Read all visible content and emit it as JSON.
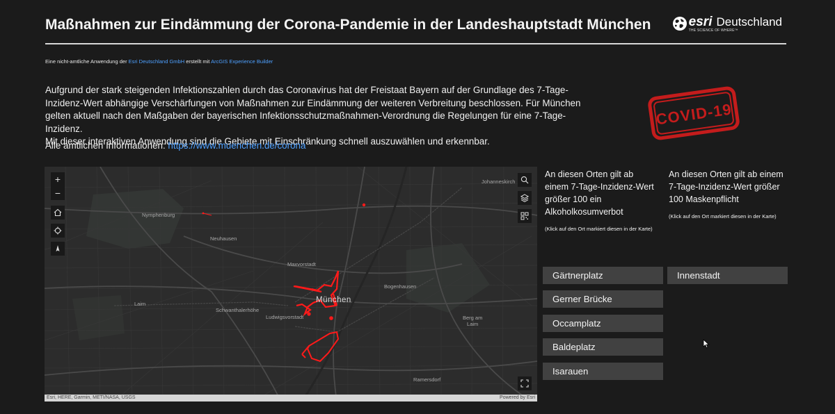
{
  "header": {
    "title": "Maßnahmen zur Eindämmung der Corona-Pandemie in der Landeshauptstadt München",
    "logo": {
      "brand": "esri",
      "region": "Deutschland",
      "tagline": "THE SCIENCE OF WHERE™"
    }
  },
  "credit": {
    "prefix": "Eine nicht-amtliche Anwendung der",
    "company": "Esri Deutschland GmbH",
    "middle": "erstellt mit",
    "tool": "ArcGIS Experience Builder"
  },
  "intro": {
    "paragraph": "Aufgrund der stark steigenden Infektionszahlen durch das Coronavirus hat der Freistaat Bayern auf der Grundlage des 7-Tage-Inzidenz-Wert abhängige Verschärfungen von Maßnahmen zur Eindämmung der weiteren Verbreitung beschlossen. Für München gelten aktuell nach den Maßgaben der bayerischen Infektionsschutzmaßnahmen-Verordnung die Regelungen für eine 7-Tage-Inzidenz.",
    "paragraph2": "Mit dieser interaktiven Anwendung sind die Gebiete mit Einschränkung schnell auszuwählen und erkennbar.",
    "info_label": "Alle amtlichen Informationen:",
    "info_link": "https://www.muenchen.de/corona"
  },
  "stamp": {
    "text": "COVID-19",
    "color": "#c41c1c"
  },
  "map": {
    "labels": {
      "nymphenburg": "Nymphenburg",
      "neuhausen": "Neuhausen",
      "maxvorstadt": "Maxvorstadt",
      "bogenhausen": "Bogenhausen",
      "muenchen": "München",
      "laim": "Laim",
      "schwanthalerhoehe": "Schwanthalerhöhe",
      "ludwigsvorstadt": "Ludwigsvorstadt",
      "berg_am_laim": "Berg am\nLaim",
      "ramersdorf": "Ramersdorf",
      "johanneskirchen": "Johanneskirch"
    },
    "attribution": "Esri, HERE, Garmin, METI/NASA, USGS",
    "powered_by": "Powered by Esri",
    "zoom_in": "+",
    "zoom_out": "−",
    "highlight_color": "#ff1a1a"
  },
  "alcohol": {
    "heading": "An diesen Orten gilt ab einem 7-Tage-Inzidenz-Wert größer 100 ein Alkoholkosumverbot",
    "note": "(Klick auf den Ort markiert diesen in der Karte)",
    "places": [
      "Gärtnerplatz",
      "Gerner Brücke",
      "Occamplatz",
      "Baldeplatz",
      "Isarauen"
    ]
  },
  "mask": {
    "heading": "An diesen Orten gilt ab einem 7-Tage-Inzidenz-Wert größer 100 Maskenpflicht",
    "note": "(Klick auf den Ort markiert diesen in der Karte)",
    "places": [
      "Innenstadt"
    ]
  }
}
